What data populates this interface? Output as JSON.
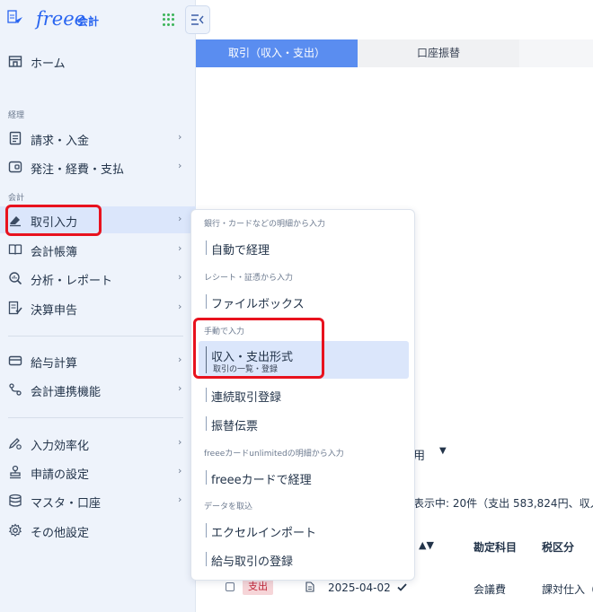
{
  "app": {
    "logo": "freee",
    "logo_sub": "会計"
  },
  "sidebar": {
    "home": "ホーム",
    "sections": {
      "keiri": "経理",
      "kaikei": "会計"
    },
    "items": [
      {
        "label": "請求・入金"
      },
      {
        "label": "発注・経費・支払"
      },
      {
        "label": "取引入力"
      },
      {
        "label": "会計帳簿"
      },
      {
        "label": "分析・レポート"
      },
      {
        "label": "決算申告"
      },
      {
        "label": "給与計算"
      },
      {
        "label": "会計連携機能"
      },
      {
        "label": "入力効率化"
      },
      {
        "label": "申請の設定"
      },
      {
        "label": "マスタ・口座"
      },
      {
        "label": "その他設定"
      }
    ],
    "chevron": "›"
  },
  "tabs": [
    {
      "label": "取引（収入・支出）"
    },
    {
      "label": "口座振替"
    }
  ],
  "flyout": {
    "categories": [
      "銀行・カードなどの明細から入力",
      "レシート・証憑から入力",
      "手動で入力",
      "freeeカードunlimitedの明細から入力",
      "データを取込"
    ],
    "items": [
      {
        "label": "自動で経理"
      },
      {
        "label": "ファイルボックス"
      },
      {
        "label": "収入・支出形式",
        "sub": "取引の一覧・登録"
      },
      {
        "label": "連続取引登録"
      },
      {
        "label": "振替伝票"
      },
      {
        "label": "freeeカードで経理"
      },
      {
        "label": "エクセルインポート"
      },
      {
        "label": "給与取引の登録"
      }
    ]
  },
  "background": {
    "dropdown_partial": "用",
    "summary_partial": "表示中: 20件（支出 583,824円、収入",
    "col_account": "勘定科目",
    "col_tax": "税区分",
    "row": {
      "type": "支出",
      "date": "2025-04-02",
      "account": "会議費",
      "tax": "課対仕入（"
    }
  },
  "colors": {
    "accent": "#5a8df0",
    "brand": "#2864f0",
    "highlight": "#e8121e"
  }
}
